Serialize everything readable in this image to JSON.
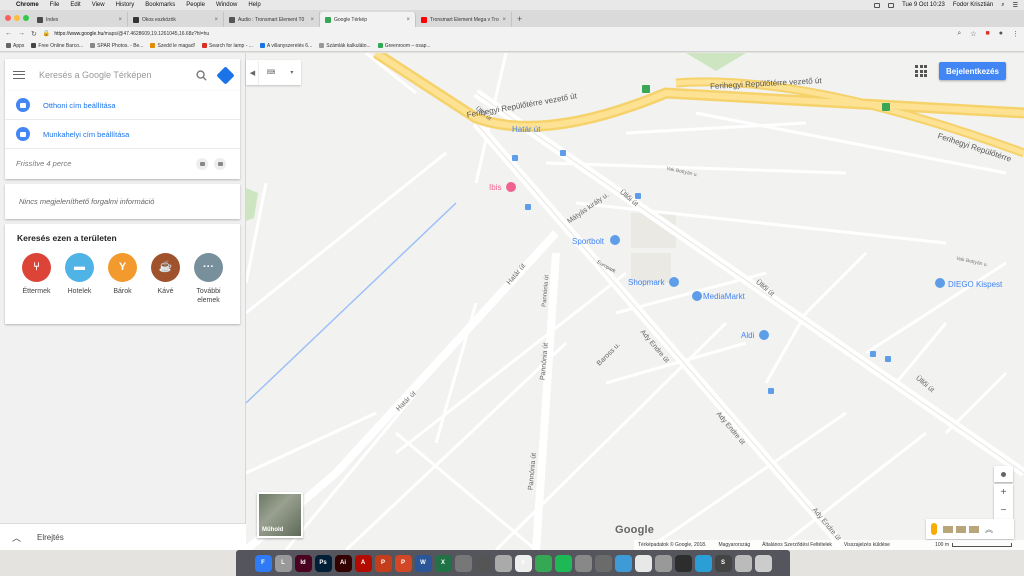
{
  "menubar": {
    "apple": "",
    "items": [
      "Chrome",
      "File",
      "Edit",
      "View",
      "History",
      "Bookmarks",
      "People",
      "Window",
      "Help"
    ],
    "clock": "Tue 9 Oct  10:23",
    "user": "Fodor Krisztián"
  },
  "tabs": [
    {
      "title": "Index",
      "favicon": "#4a4a4a"
    },
    {
      "title": "Okos eszközök",
      "favicon": "#333333"
    },
    {
      "title": "Audio : Tronsmart Element T0",
      "favicon": "#555555"
    },
    {
      "title": "Google Térkép",
      "favicon": "#34a853",
      "active": true
    },
    {
      "title": "Tronsmart Element Mega v Tro",
      "favicon": "#ff0000"
    }
  ],
  "address": {
    "host": "https://www.google.hu",
    "path": "/maps/@47.4628609,19.1261045,16.68z?hl=hu"
  },
  "bookmarks": [
    {
      "label": "Apps",
      "color": "#666"
    },
    {
      "label": "Free Online Barco...",
      "color": "#444"
    },
    {
      "label": "SPAR Photos. - Be...",
      "color": "#888"
    },
    {
      "label": "Szedd le magad!",
      "color": "#e08b00"
    },
    {
      "label": "Search for lamp - ...",
      "color": "#d93025"
    },
    {
      "label": "A villanyszerelés 6...",
      "color": "#1a73e8"
    },
    {
      "label": "Számlák kalkuláto...",
      "color": "#999"
    },
    {
      "label": "Greenroom – osap...",
      "color": "#34a853"
    }
  ],
  "search": {
    "placeholder": "Keresés a Google Térképen"
  },
  "home": {
    "home_label": "Otthoni cím beállítása",
    "work_label": "Munkahelyi cím beállítása",
    "updated": "Frissítve 4 perce"
  },
  "traffic": "Nincs megjeleníthető forgalmi információ",
  "area": {
    "title": "Keresés ezen a területen",
    "categories": [
      {
        "label": "Éttermek",
        "color": "#db4437"
      },
      {
        "label": "Hotelek",
        "color": "#4fb4e5"
      },
      {
        "label": "Bárok",
        "color": "#f29a2e"
      },
      {
        "label": "Kávé",
        "color": "#a0522d"
      },
      {
        "label": "További elemek",
        "color": "#78909c"
      }
    ]
  },
  "bottom": {
    "label": "Elrejtés"
  },
  "map": {
    "login": "Bejelentkezés",
    "satellite": "Műhold",
    "google": "Google",
    "labels": {
      "airport_road_1": "Ferihegyi Repülőtérre vezető út",
      "airport_road_2": "Ferihegyi Repülőtérre vezető út",
      "airport_road_3": "Ferihegyi Repülőtérre",
      "hatar_ut_station": "Határ út",
      "ibis": "Ibis",
      "ulloi_1": "Üllői út",
      "ulloi_2": "Üllői út",
      "ulloi_3": "Üllői út",
      "ulloi_4": "Üllői út",
      "matyas_kiraly": "Mátyás király u.",
      "sportbolt": "Sportbolt",
      "shopmark": "Shopmark",
      "mediamarkt": "MediaMarkt",
      "europark": "Europark",
      "aldi": "Aldi",
      "diego": "DIEGO Kispest",
      "hatar_ut_1": "Határ út",
      "hatar_ut_2": "Határ út",
      "pannonia_1": "Pannónia út",
      "pannonia_2": "Pannónia út",
      "pannonia_3": "Pannónia út",
      "baross": "Baross u.",
      "ady_1": "Ady Endre út",
      "ady_2": "Ady Endre út",
      "ady_3": "Ady Endre út",
      "vak_bottyan": "Vak Bottyán u.",
      "vak_bottyan_2": "Vak Bottyán u."
    },
    "attribution": {
      "data": "Térképadatok © Google, 2018.",
      "country": "Magyarország",
      "terms": "Általános Szerződési Feltételek",
      "feedback": "Visszajelzés küldése",
      "scale": "100 m"
    },
    "road_badge": "4"
  },
  "dock": [
    {
      "label": "F",
      "color": "#2f7bf5"
    },
    {
      "label": "L",
      "color": "#999"
    },
    {
      "label": "Id",
      "color": "#49021f"
    },
    {
      "label": "Ps",
      "color": "#001e36"
    },
    {
      "label": "Ai",
      "color": "#330000"
    },
    {
      "label": "A",
      "color": "#b30b00"
    },
    {
      "label": "P",
      "color": "#c43e1c"
    },
    {
      "label": "P",
      "color": "#d24726"
    },
    {
      "label": "W",
      "color": "#2b579a"
    },
    {
      "label": "X",
      "color": "#217346"
    },
    {
      "label": "",
      "color": "#777"
    },
    {
      "label": "",
      "color": "#555"
    },
    {
      "label": "",
      "color": "#aaa"
    },
    {
      "label": "9",
      "color": "#eee"
    },
    {
      "label": "",
      "color": "#34a853"
    },
    {
      "label": "",
      "color": "#1db954"
    },
    {
      "label": "",
      "color": "#888"
    },
    {
      "label": "",
      "color": "#6b6b6b"
    },
    {
      "label": "",
      "color": "#3d9bd7"
    },
    {
      "label": "",
      "color": "#e8e8e8"
    },
    {
      "label": "",
      "color": "#999"
    },
    {
      "label": "",
      "color": "#2d2d2d"
    },
    {
      "label": "",
      "color": "#2a9fd6"
    },
    {
      "label": "S",
      "color": "#444"
    },
    {
      "label": "",
      "color": "#bbb"
    },
    {
      "label": "",
      "color": "#ccc"
    }
  ]
}
